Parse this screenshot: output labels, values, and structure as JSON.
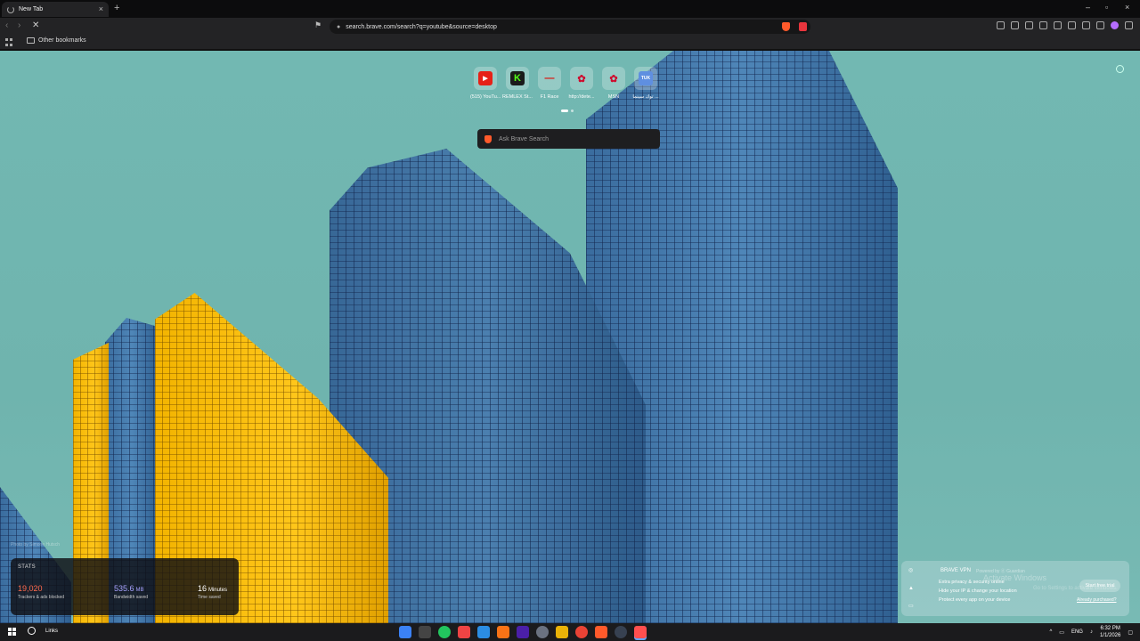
{
  "browser": {
    "tab": {
      "title": "New Tab",
      "close": "×"
    },
    "new_tab": "+",
    "window_controls": [
      "–",
      "▫",
      "×"
    ],
    "url": "search.brave.com/search?q=youtube&source=desktop",
    "bookmarks": {
      "other": "Other bookmarks"
    }
  },
  "newtab_page": {
    "top_sites": [
      {
        "label": "(515) YouTu...",
        "icon": "youtube-icon",
        "color": "#e62117",
        "glyph": "▶"
      },
      {
        "label": "REMLEX St...",
        "icon": "kick-icon",
        "color": "#53fc18",
        "glyph": "K"
      },
      {
        "label": "F1 Race",
        "icon": "f1-icon",
        "color": "#e10600",
        "glyph": "―"
      },
      {
        "label": "http://dete...",
        "icon": "huawei-icon",
        "color": "#cf0a2c",
        "glyph": "✿"
      },
      {
        "label": "MSN",
        "icon": "huawei-icon",
        "color": "#cf0a2c",
        "glyph": "✿"
      },
      {
        "label": "توك سينما ...",
        "icon": "tuktuk-icon",
        "color": "#2d6bd6",
        "glyph": "TUK"
      }
    ],
    "search_placeholder": "Ask Brave Search",
    "photo_credit": "Photo by Simone Hutsch",
    "stats": {
      "title": "STATS",
      "trackers": {
        "value": "19,020",
        "label": "Trackers & ads blocked",
        "color": "#ff6a4d"
      },
      "bandwidth": {
        "value": "535.6",
        "unit": "MB",
        "label": "Bandwidth saved",
        "color": "#a7a2ff"
      },
      "time": {
        "value": "16",
        "unit": "Minutes",
        "label": "Time saved",
        "color": "#ffffff"
      }
    },
    "vpn": {
      "title": "BRAVE VPN",
      "powered": "Powered by ⓖ Guardian",
      "lines": [
        "Extra privacy & security online",
        "Hide your IP & change your location",
        "Protect every app on your device"
      ],
      "button": "Start free trial",
      "link": "Already purchased?"
    },
    "activate": {
      "title": "Activate Windows",
      "sub": "Go to Settings to activate Windows."
    }
  },
  "taskbar": {
    "links": "Links",
    "apps": [
      {
        "name": "app-icon-1",
        "color": "#3b82f6"
      },
      {
        "name": "app-icon-2",
        "color": "#444"
      },
      {
        "name": "app-icon-3",
        "color": "#22c55e"
      },
      {
        "name": "app-icon-4",
        "color": "#ef4444"
      },
      {
        "name": "vscode-icon",
        "color": "#2b8de3"
      },
      {
        "name": "app-icon-6",
        "color": "#f97316"
      },
      {
        "name": "after-effects-icon",
        "color": "#4b1fa8"
      },
      {
        "name": "app-icon-8",
        "color": "#6b7280"
      },
      {
        "name": "file-explorer-icon",
        "color": "#eab308"
      },
      {
        "name": "chrome-icon",
        "color": "#ea4335"
      },
      {
        "name": "brave-icon",
        "color": "#ff5a2b"
      },
      {
        "name": "app-icon-12",
        "color": "#374151"
      },
      {
        "name": "brave-active-icon",
        "color": "#ff4f4f"
      }
    ],
    "lang": "ENG",
    "time": "6:32 PM",
    "date": "1/1/2026",
    "tray_up": "^"
  }
}
